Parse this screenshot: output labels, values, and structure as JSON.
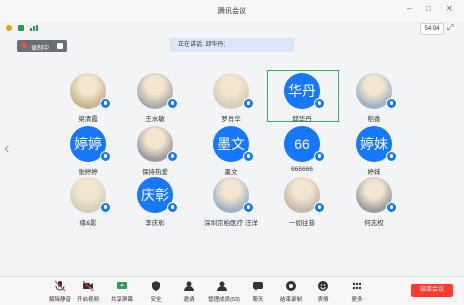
{
  "app": {
    "title": "腾讯会议",
    "clock": "54:04"
  },
  "recording": {
    "label": "录制中"
  },
  "speaking": {
    "text": "正在讲话: 邱华丹;"
  },
  "participants": [
    {
      "name": "梁清霞",
      "avatar": "photo"
    },
    {
      "name": "王水敏",
      "avatar": "photo"
    },
    {
      "name": "罗肖华",
      "avatar": "photo"
    },
    {
      "name": "邱华丹",
      "avatar": "text",
      "avatar_text": "华丹",
      "selected": true
    },
    {
      "name": "稻香",
      "avatar": "photo"
    },
    {
      "name": "张婷婷",
      "avatar": "text",
      "avatar_text": "婷婷"
    },
    {
      "name": "保持热爱",
      "avatar": "photo"
    },
    {
      "name": "墨文",
      "avatar": "text",
      "avatar_text": "墨文"
    },
    {
      "name": "666666",
      "avatar": "text",
      "avatar_text": "66"
    },
    {
      "name": "婷妹",
      "avatar": "text",
      "avatar_text": "婷妹"
    },
    {
      "name": "缘&影",
      "avatar": "photo"
    },
    {
      "name": "李庆彰",
      "avatar": "text",
      "avatar_text": "庆彰"
    },
    {
      "name": "深圳京柏医疗 汪洋",
      "avatar": "photo"
    },
    {
      "name": "一如往昔",
      "avatar": "photo"
    },
    {
      "name": "何志权",
      "avatar": "photo"
    }
  ],
  "toolbar": {
    "mute": "解除静音",
    "video": "开启视频",
    "share": "共享屏幕",
    "security": "安全",
    "invite": "邀请",
    "members": "管理成员(53)",
    "chat": "聊天",
    "stop_record": "结束录制",
    "reaction": "表情",
    "more": "更多",
    "end": "结束会议"
  },
  "colors": {
    "accent": "#1677ff",
    "end": "#ff3b30",
    "selected": "#27b56f"
  }
}
